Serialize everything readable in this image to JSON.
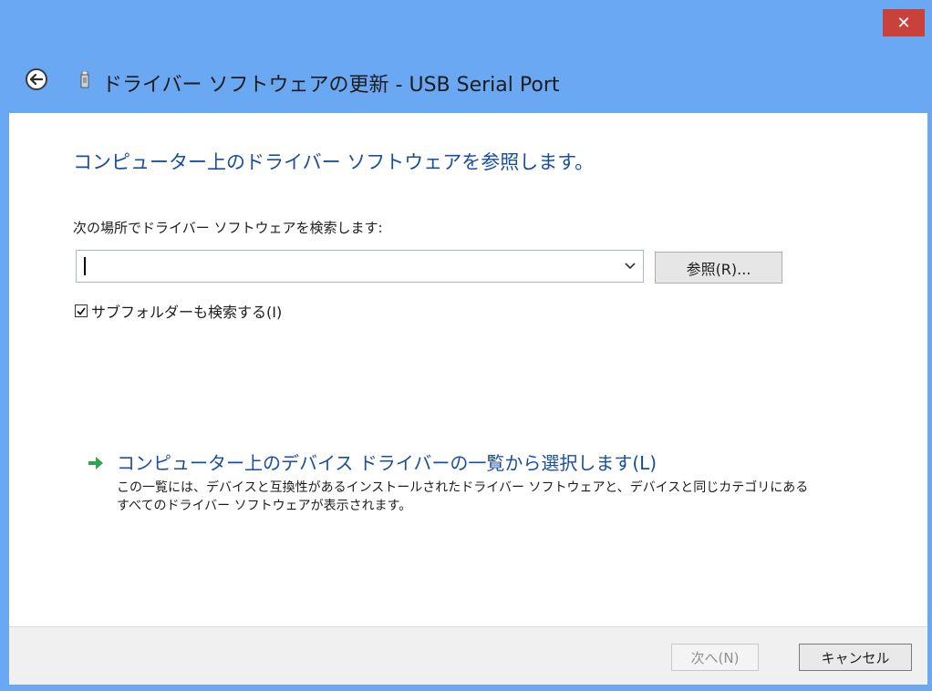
{
  "window": {
    "title": "ドライバー ソフトウェアの更新 - USB Serial Port",
    "close_label": "✕"
  },
  "main": {
    "heading": "コンピューター上のドライバー ソフトウェアを参照します。",
    "search_label": "次の場所でドライバー ソフトウェアを検索します:",
    "path_value": "",
    "browse_label": "参照(R)...",
    "include_subfolders_label": "サブフォルダーも検索する(I)",
    "include_subfolders_checked": true,
    "pick_title": "コンピューター上のデバイス ドライバーの一覧から選択します(L)",
    "pick_desc": "この一覧には、デバイスと互換性があるインストールされたドライバー ソフトウェアと、デバイスと同じカテゴリにあるすべてのドライバー ソフトウェアが表示されます。"
  },
  "footer": {
    "next_label": "次へ(N)",
    "cancel_label": "キャンセル"
  },
  "colors": {
    "frame": "#6aa8f4",
    "heading": "#1a4ea0",
    "close": "#c8413a",
    "arrow_green": "#2ea44f"
  },
  "icons": {
    "back": "back-arrow-icon",
    "device": "usb-device-icon",
    "close": "close-icon",
    "dropdown": "chevron-down-icon",
    "check": "checkmark-icon",
    "pick": "green-arrow-icon"
  }
}
